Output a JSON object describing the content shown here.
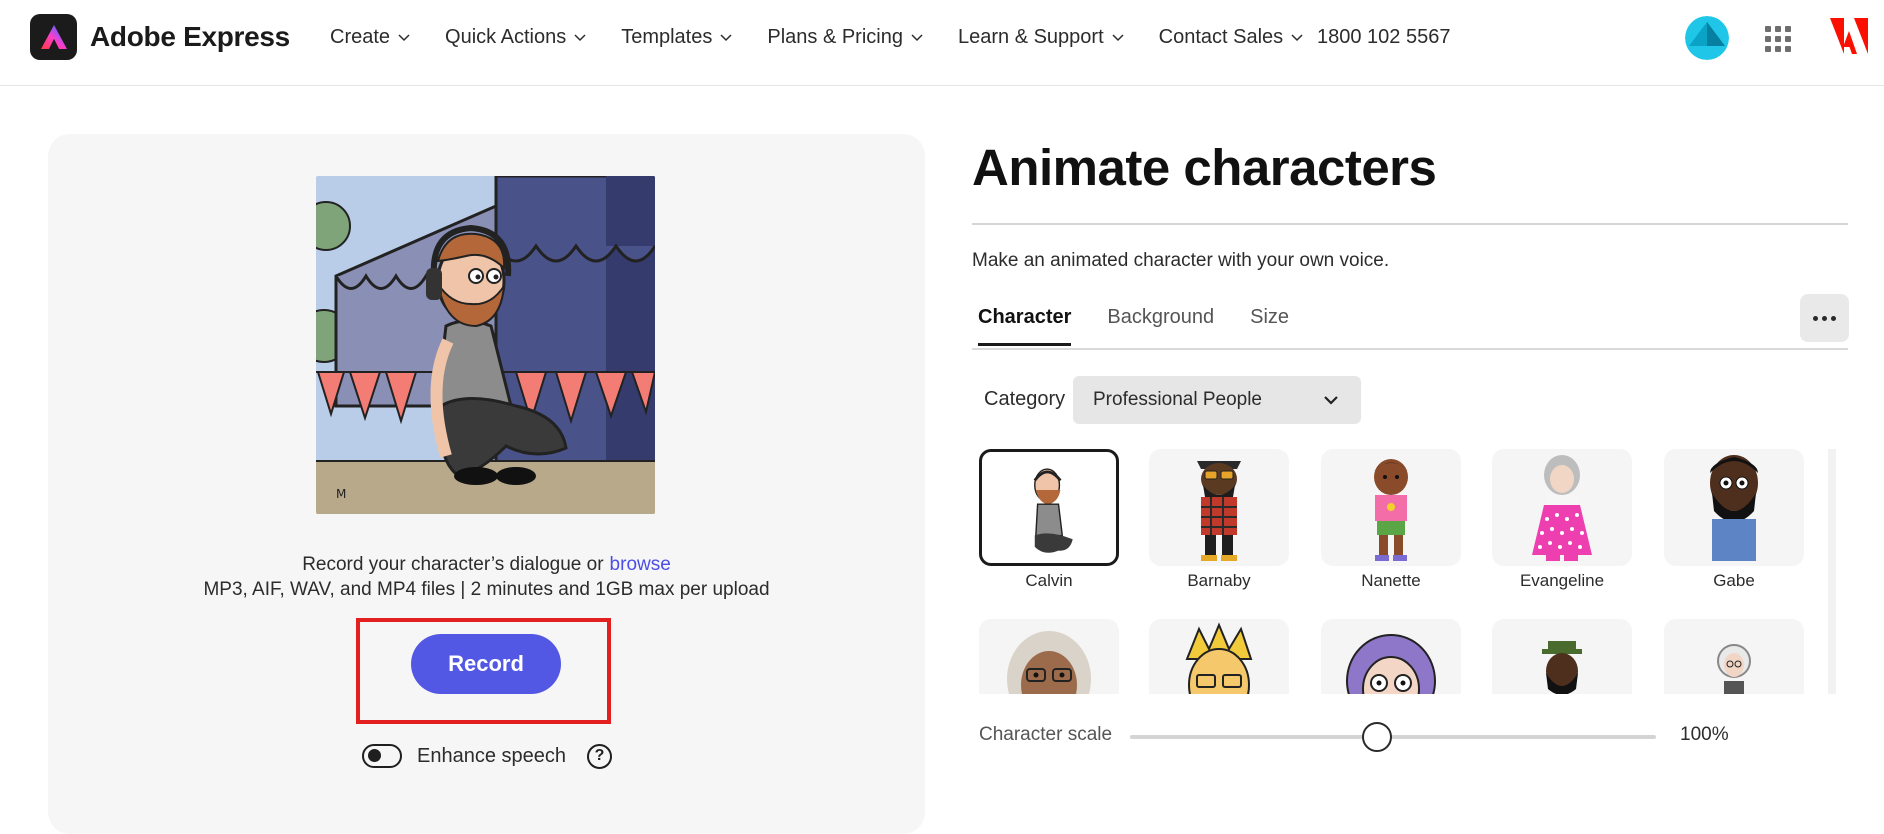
{
  "header": {
    "brand": "Adobe Express",
    "nav": [
      {
        "label": "Create"
      },
      {
        "label": "Quick Actions"
      },
      {
        "label": "Templates"
      },
      {
        "label": "Plans & Pricing"
      },
      {
        "label": "Learn & Support"
      },
      {
        "label": "Contact Sales"
      }
    ],
    "phone": "1800 102 5567",
    "icons": [
      "user-avatar",
      "apps-grid-icon",
      "adobe-logo"
    ]
  },
  "left": {
    "hint_line1": "Record your character’s dialogue or",
    "browse_label": "browse",
    "hint_line2": "MP3, AIF, WAV, and MP4 files | 2 minutes and 1GB max per upload",
    "record_label": "Record",
    "enhance_label": "Enhance speech",
    "enhance_on": false,
    "help_glyph": "?"
  },
  "right": {
    "title": "Animate characters",
    "subtitle": "Make an animated character with your own voice.",
    "tabs": [
      {
        "label": "Character",
        "active": true
      },
      {
        "label": "Background",
        "active": false
      },
      {
        "label": "Size",
        "active": false
      }
    ],
    "category_label": "Category",
    "category_value": "Professional People",
    "characters": [
      {
        "name": "Calvin",
        "selected": true
      },
      {
        "name": "Barnaby",
        "selected": false
      },
      {
        "name": "Nanette",
        "selected": false
      },
      {
        "name": "Evangeline",
        "selected": false
      },
      {
        "name": "Gabe",
        "selected": false
      }
    ],
    "scale_label": "Character scale",
    "scale_value": "100%",
    "scale_fraction": 0.47
  },
  "colors": {
    "accent": "#5258e4",
    "highlight": "#e3201f",
    "link": "#4b4fe6",
    "adobe_red": "#fa0f00"
  }
}
